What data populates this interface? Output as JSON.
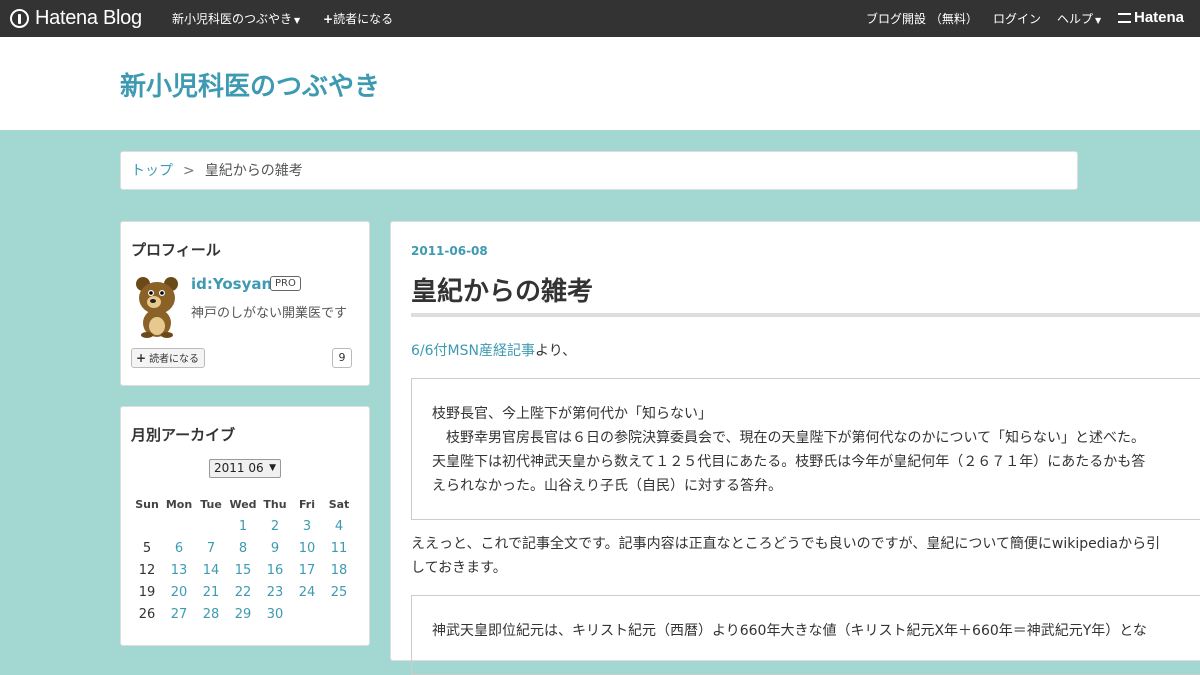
{
  "topbar": {
    "logo_text": "Hatena Blog",
    "blog_name": "新小児科医のつぶやき",
    "follow_label": "読者になる",
    "open_blog_label": "ブログ開設 （無料）",
    "login_label": "ログイン",
    "help_label": "ヘルプ",
    "hatena_logo": "Hatena"
  },
  "header": {
    "title": "新小児科医のつぶやき"
  },
  "breadcrumb": {
    "top": "トップ",
    "separator": ">",
    "current": "皇紀からの雑考"
  },
  "profile": {
    "title": "プロフィール",
    "id": "id:Yosyan",
    "badge": "PRO",
    "description": "神戸のしがない開業医です",
    "subscribe_label": "読者になる",
    "subscriber_count": "9"
  },
  "archive": {
    "title": "月別アーカイブ",
    "selected_month": "2011 06",
    "weekdays": [
      "Sun",
      "Mon",
      "Tue",
      "Wed",
      "Thu",
      "Fri",
      "Sat"
    ],
    "weeks": [
      [
        "",
        "",
        "",
        "1",
        "2",
        "3",
        "4"
      ],
      [
        "5",
        "6",
        "7",
        "8",
        "9",
        "10",
        "11"
      ],
      [
        "12",
        "13",
        "14",
        "15",
        "16",
        "17",
        "18"
      ],
      [
        "19",
        "20",
        "21",
        "22",
        "23",
        "24",
        "25"
      ],
      [
        "26",
        "27",
        "28",
        "29",
        "30",
        "",
        ""
      ]
    ],
    "plain_days": [
      "5",
      "12",
      "19",
      "26"
    ]
  },
  "entry": {
    "date": "2011-06-08",
    "title": "皇紀からの雑考",
    "source_link": "6/6付MSN産経記事",
    "source_suffix": "より、",
    "quote_lines": [
      "枝野長官、今上陛下が第何代か「知らない」",
      "　枝野幸男官房長官は６日の参院決算委員会で、現在の天皇陛下が第何代なのかについて「知らない」と述べた。",
      "天皇陛下は初代神武天皇から数えて１２５代目にあたる。枝野氏は今年が皇紀何年（２６７１年）にあたるかも答",
      "えられなかった。山谷えり子氏（自民）に対する答弁。"
    ],
    "para2_lines": [
      "ええっと、これで記事全文です。記事内容は正直なところどうでも良いのですが、皇紀について簡便にwikipediaから引",
      "しておきます。"
    ],
    "quote2_line": "神武天皇即位紀元は、キリスト紀元（西暦）より660年大きな値（キリスト紀元X年＋660年＝神武紀元Y年）とな"
  }
}
